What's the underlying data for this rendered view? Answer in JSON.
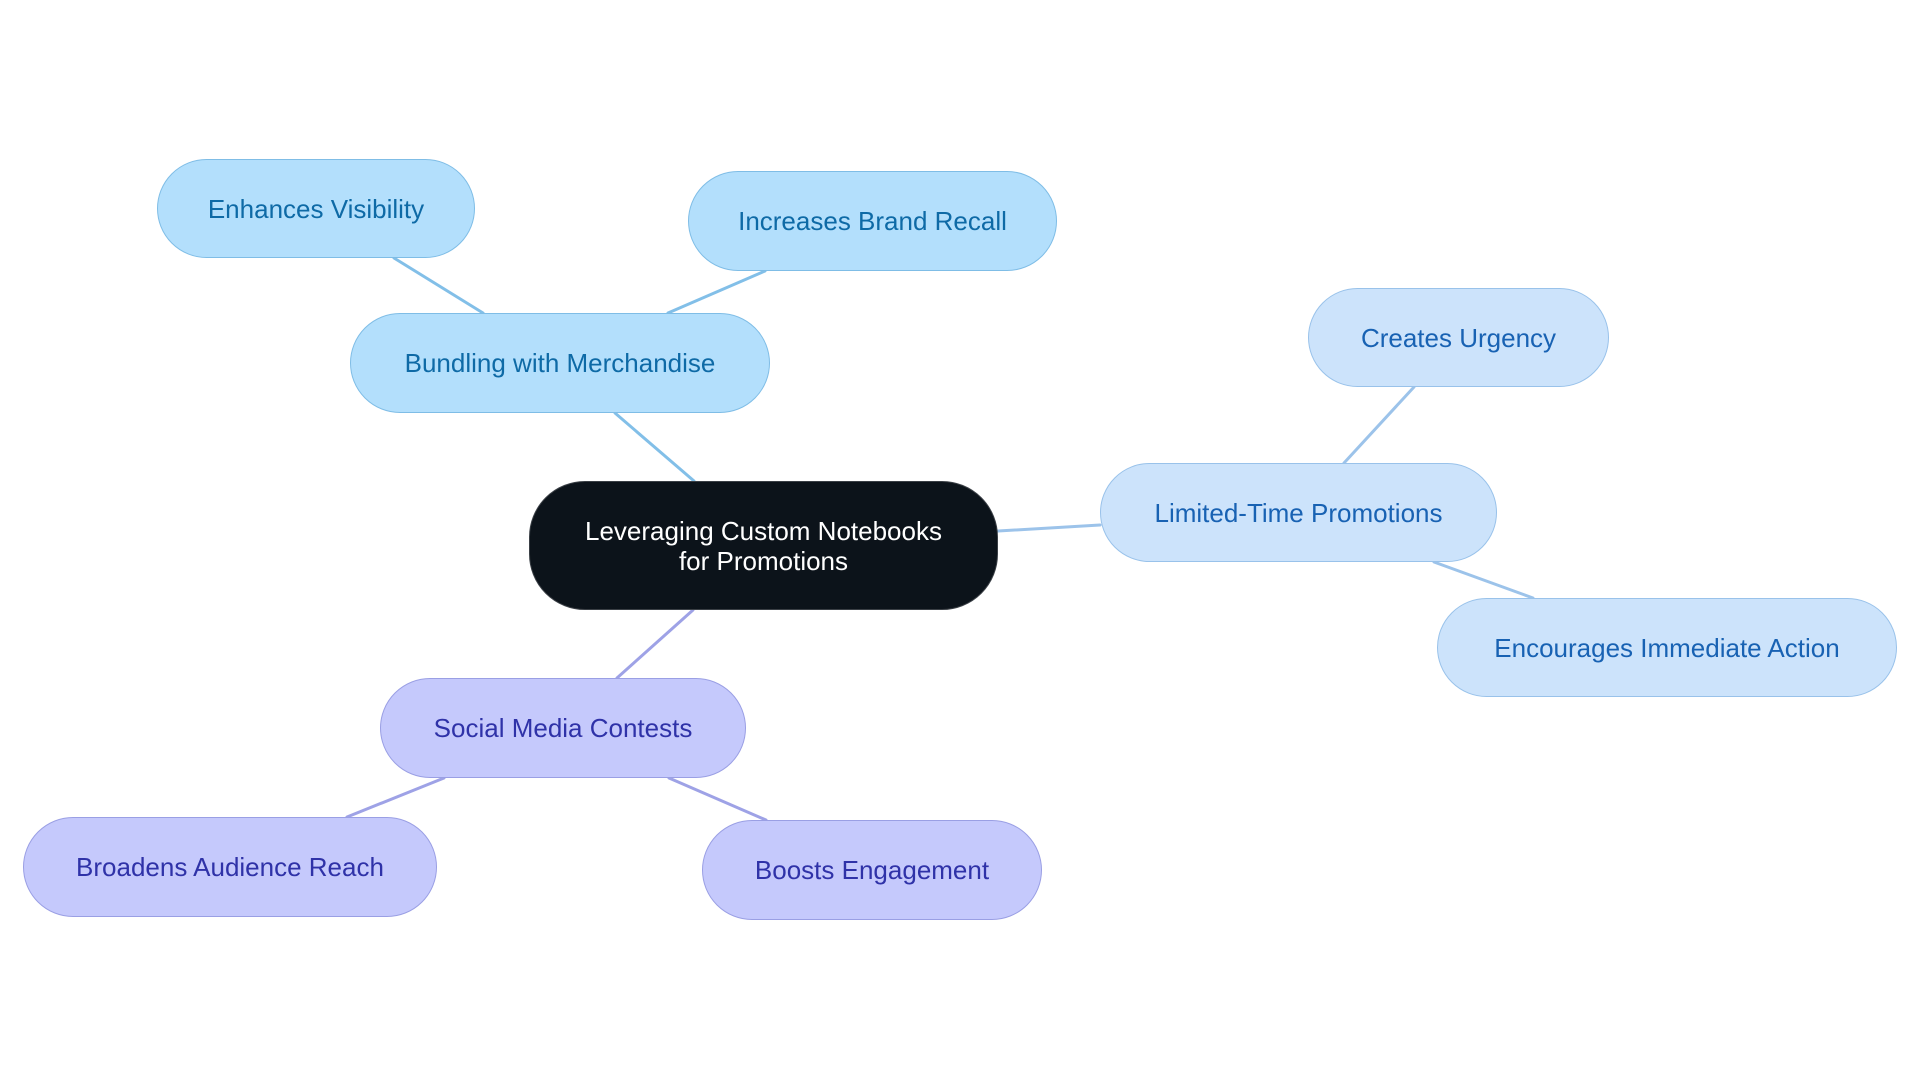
{
  "diagram": {
    "type": "mind-map",
    "root": {
      "id": "root",
      "label_lines": [
        "Leveraging Custom Notebooks",
        "for Promotions"
      ]
    },
    "branches": [
      {
        "id": "bundling",
        "label": "Bundling with Merchandise",
        "theme": "sky",
        "children": [
          {
            "id": "visibility",
            "label": "Enhances Visibility"
          },
          {
            "id": "recall",
            "label": "Increases Brand Recall"
          }
        ]
      },
      {
        "id": "limited",
        "label": "Limited-Time Promotions",
        "theme": "blue",
        "children": [
          {
            "id": "urgency",
            "label": "Creates Urgency"
          },
          {
            "id": "action",
            "label": "Encourages Immediate Action"
          }
        ]
      },
      {
        "id": "social",
        "label": "Social Media Contests",
        "theme": "violet",
        "children": [
          {
            "id": "reach",
            "label": "Broadens Audience Reach"
          },
          {
            "id": "engagement",
            "label": "Boosts Engagement"
          }
        ]
      }
    ],
    "edges": [
      {
        "from": "root",
        "to": "bundling",
        "color": "#82bfe8"
      },
      {
        "from": "root",
        "to": "limited",
        "color": "#9cc3ea"
      },
      {
        "from": "root",
        "to": "social",
        "color": "#9ea2e6"
      },
      {
        "from": "bundling",
        "to": "visibility",
        "color": "#82bfe8"
      },
      {
        "from": "bundling",
        "to": "recall",
        "color": "#82bfe8"
      },
      {
        "from": "limited",
        "to": "urgency",
        "color": "#9cc3ea"
      },
      {
        "from": "limited",
        "to": "action",
        "color": "#9cc3ea"
      },
      {
        "from": "social",
        "to": "reach",
        "color": "#9ea2e6"
      },
      {
        "from": "social",
        "to": "engagement",
        "color": "#9ea2e6"
      }
    ],
    "colors": {
      "root_fill": "#0c131a",
      "root_text": "#ffffff",
      "sky_fill": "#b3dffc",
      "sky_text": "#0e6aa6",
      "blue_fill": "#cce3fb",
      "blue_text": "#1862b3",
      "violet_fill": "#c5c9fc",
      "violet_text": "#2f32a8"
    }
  }
}
